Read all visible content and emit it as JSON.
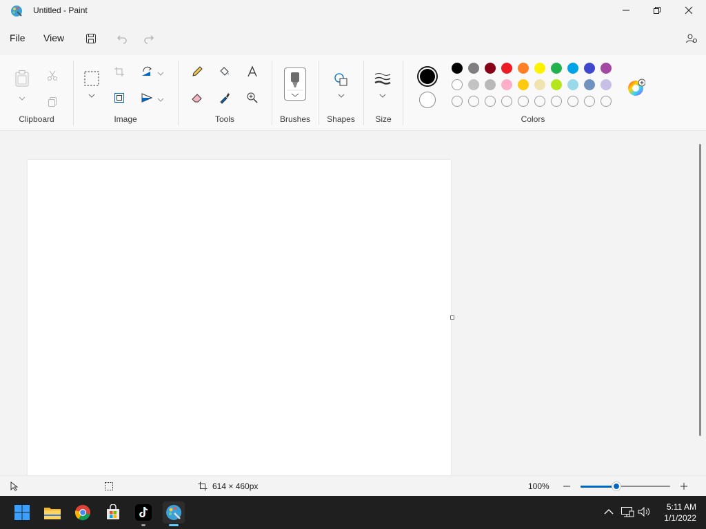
{
  "window": {
    "title": "Untitled - Paint"
  },
  "menu": {
    "file": "File",
    "view": "View"
  },
  "ribbon": {
    "groups": {
      "clipboard": "Clipboard",
      "image": "Image",
      "tools": "Tools",
      "brushes": "Brushes",
      "shapes": "Shapes",
      "size": "Size",
      "colors": "Colors"
    }
  },
  "colors": {
    "primary": "#000000",
    "secondary": "#ffffff",
    "row1": [
      "#000000",
      "#7f7f7f",
      "#880015",
      "#ed1c24",
      "#ff7f27",
      "#fff200",
      "#22b14c",
      "#00a2e8",
      "#3f48cc",
      "#a349a4"
    ],
    "row2": [
      "#ffffff",
      "#c3c3c3",
      "#b9b9b9",
      "#ffaec9",
      "#ffc90e",
      "#efe4b0",
      "#b5e61d",
      "#99d9ea",
      "#7092be",
      "#c8bfe7"
    ],
    "row3_empty_count": 10,
    "accent": "#0067c0"
  },
  "status": {
    "canvas_size": "614 × 460px",
    "zoom": "100%",
    "zoom_level": 0.4
  },
  "taskbar": {
    "time": "5:11 AM",
    "date": "1/1/2022",
    "apps": [
      "start",
      "file-explorer",
      "chrome",
      "microsoft-store",
      "tiktok",
      "paint"
    ]
  }
}
